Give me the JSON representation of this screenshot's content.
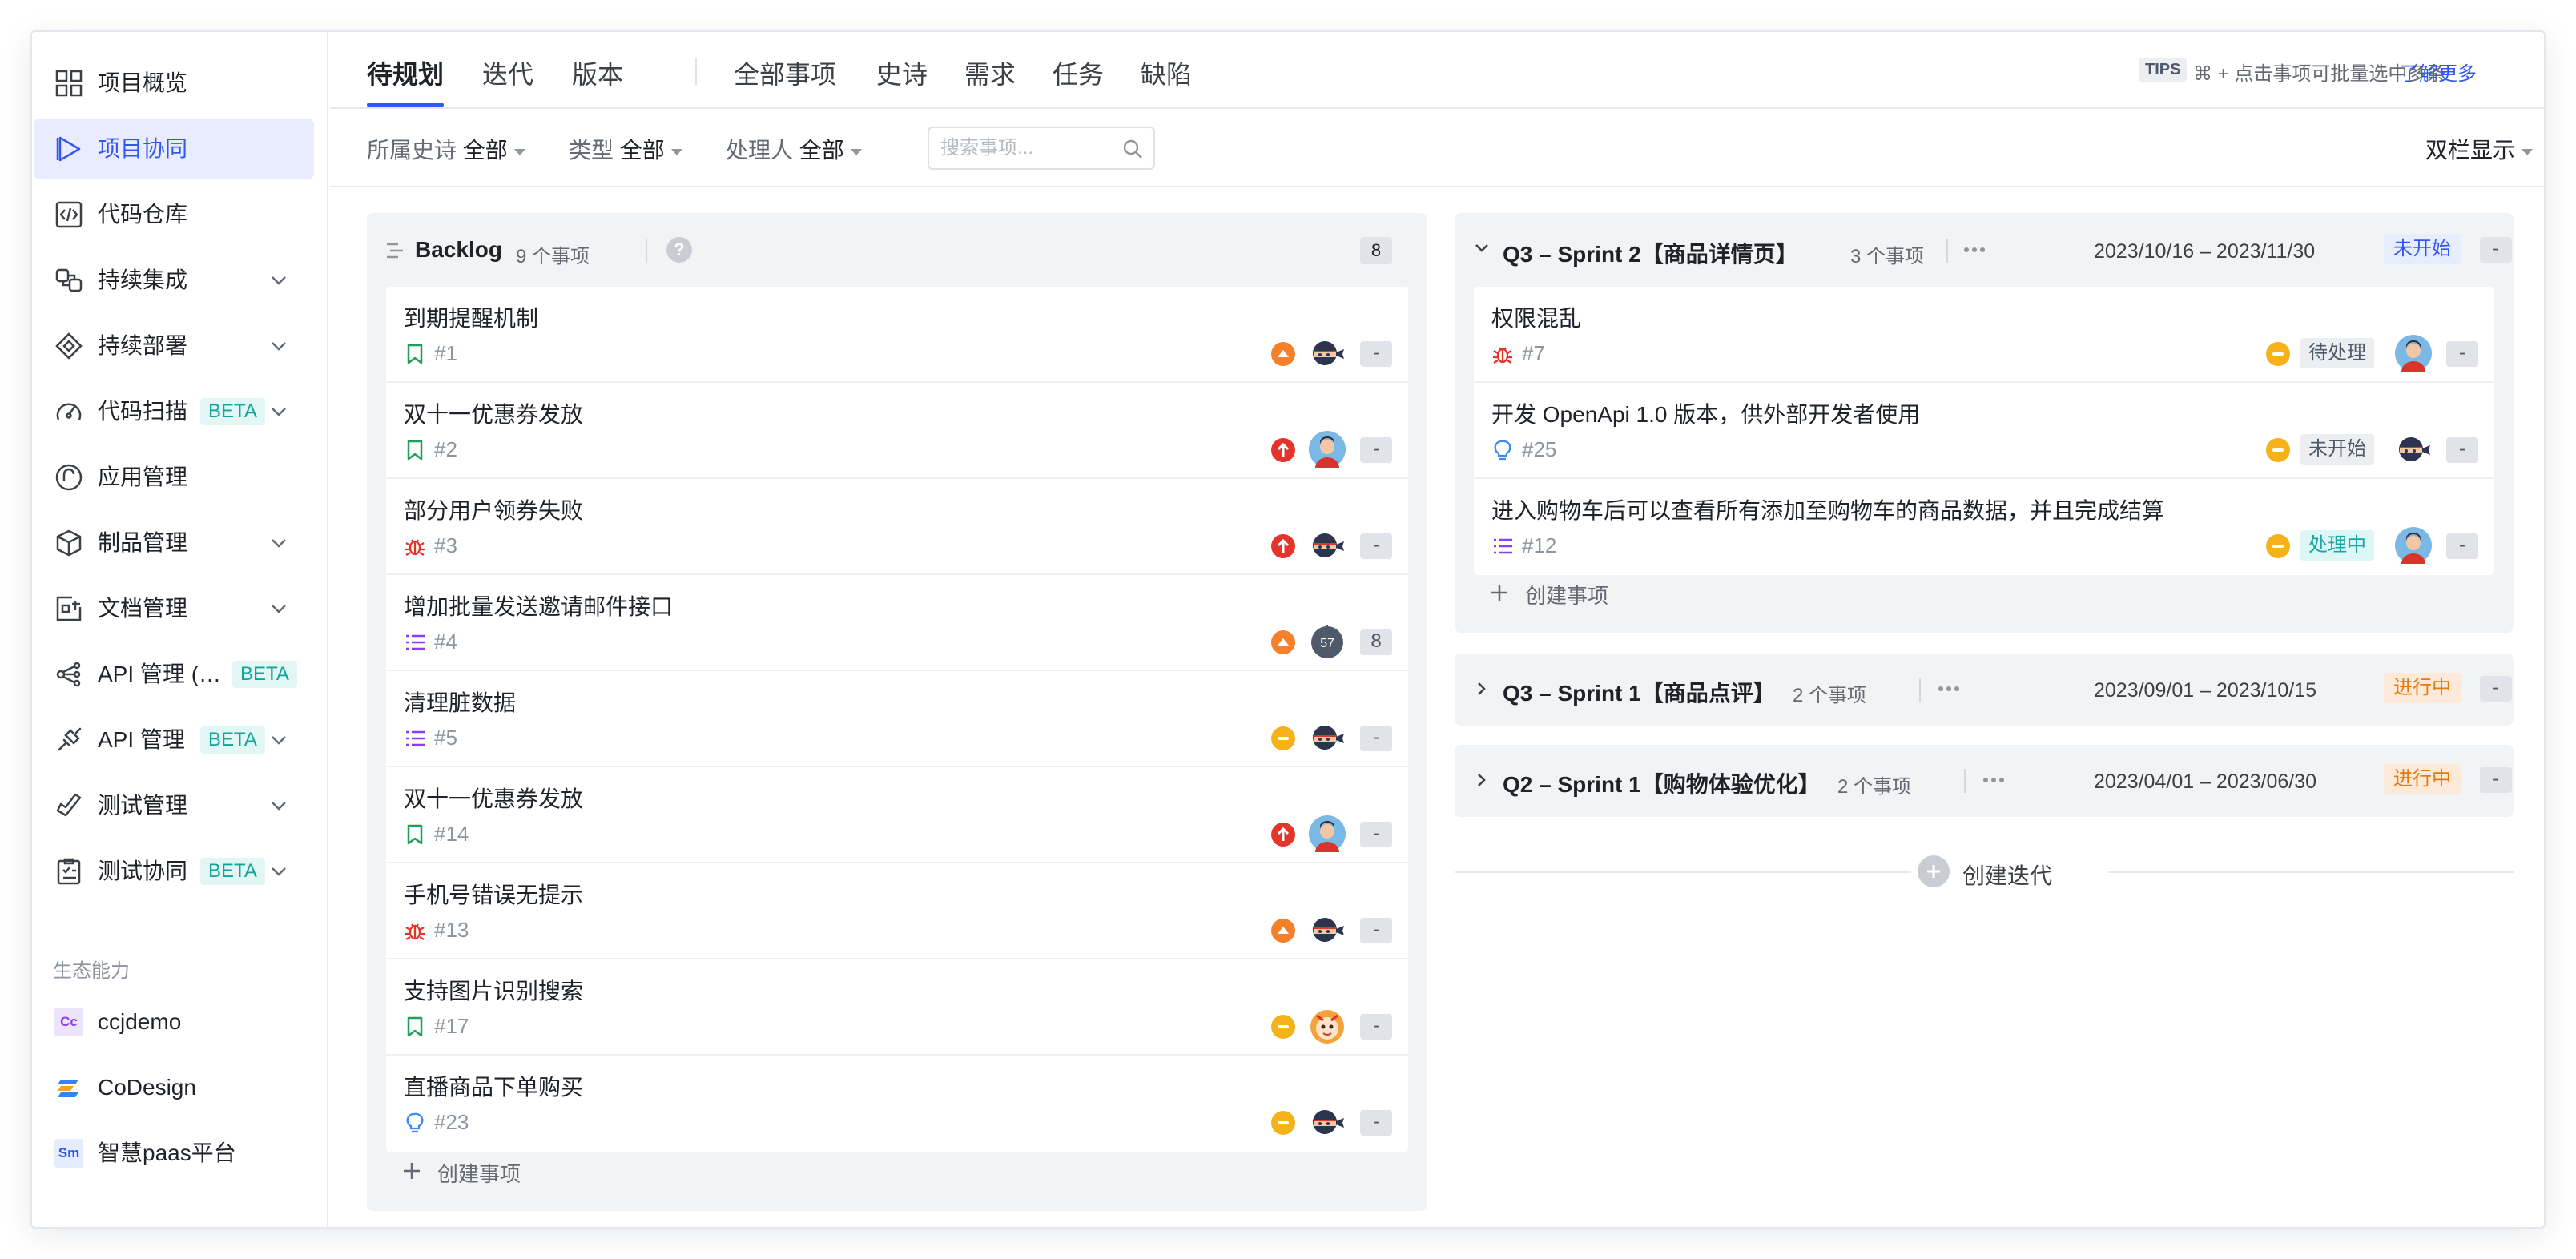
{
  "sidebar": {
    "items": [
      {
        "label": "项目概览",
        "icon": "grid-icon"
      },
      {
        "label": "项目协同",
        "icon": "play-icon"
      },
      {
        "label": "代码仓库",
        "icon": "code-icon"
      },
      {
        "label": "持续集成",
        "icon": "integration-icon"
      },
      {
        "label": "持续部署",
        "icon": "deploy-icon"
      },
      {
        "label": "代码扫描",
        "icon": "gauge-icon",
        "badge": "BETA"
      },
      {
        "label": "应用管理",
        "icon": "app-icon"
      },
      {
        "label": "制品管理",
        "icon": "box-icon"
      },
      {
        "label": "文档管理",
        "icon": "document-icon"
      },
      {
        "label": "API 管理 (…",
        "icon": "api-share-icon",
        "badge": "BETA"
      },
      {
        "label": "API 管理",
        "icon": "api-plug-icon",
        "badge": "BETA"
      },
      {
        "label": "测试管理",
        "icon": "test-icon"
      },
      {
        "label": "测试协同",
        "icon": "checklist-icon",
        "badge": "BETA"
      }
    ],
    "section_label": "生态能力",
    "eco": [
      {
        "label": "ccjdemo",
        "logo": "Cc"
      },
      {
        "label": "CoDesign",
        "logo": ""
      },
      {
        "label": "智慧paas平台",
        "logo": "Sm"
      }
    ]
  },
  "tabs": [
    "待规划",
    "迭代",
    "版本",
    "全部事项",
    "史诗",
    "需求",
    "任务",
    "缺陷"
  ],
  "tips": {
    "badge": "TIPS",
    "text": "⌘ + 点击事项可批量选中多条",
    "link": "了解更多"
  },
  "filters": {
    "epic": {
      "label": "所属史诗",
      "value": "全部"
    },
    "type": {
      "label": "类型",
      "value": "全部"
    },
    "assignee": {
      "label": "处理人",
      "value": "全部"
    },
    "search_placeholder": "搜索事项...",
    "view": "双栏显示"
  },
  "backlog": {
    "title": "Backlog",
    "count": "9 个事项",
    "help": "?",
    "pill": "8",
    "create": "创建事项",
    "items": [
      {
        "title": "到期提醒机制",
        "num": "#1",
        "type": "story",
        "priority": "high",
        "avatar": "ninja",
        "extra": "-"
      },
      {
        "title": "双十一优惠券发放",
        "num": "#2",
        "type": "story",
        "priority": "urgent",
        "avatar": "man",
        "extra": "-"
      },
      {
        "title": "部分用户领券失败",
        "num": "#3",
        "type": "bug",
        "priority": "urgent",
        "avatar": "ninja",
        "extra": "-"
      },
      {
        "title": "增加批量发送邀请邮件接口",
        "num": "#4",
        "type": "task",
        "priority": "high",
        "avatar": "dark",
        "avatar_text": "57",
        "extra": "8"
      },
      {
        "title": "清理脏数据",
        "num": "#5",
        "type": "task",
        "priority": "medium",
        "avatar": "ninja",
        "extra": "-"
      },
      {
        "title": "双十一优惠券发放",
        "num": "#14",
        "type": "story",
        "priority": "urgent",
        "avatar": "man",
        "extra": "-"
      },
      {
        "title": "手机号错误无提示",
        "num": "#13",
        "type": "bug",
        "priority": "high",
        "avatar": "ninja",
        "extra": "-"
      },
      {
        "title": "支持图片识别搜索",
        "num": "#17",
        "type": "story",
        "priority": "medium",
        "avatar": "cartoon",
        "extra": "-"
      },
      {
        "title": "直播商品下单购买",
        "num": "#23",
        "type": "idea",
        "priority": "medium",
        "avatar": "ninja",
        "extra": "-"
      }
    ]
  },
  "sprints": [
    {
      "title": "Q3 – Sprint 2【商品详情页】",
      "count": "3 个事项",
      "dates": "2023/10/16 – 2023/11/30",
      "status": "未开始",
      "extra": "-",
      "create": "创建事项",
      "items": [
        {
          "title": "权限混乱",
          "num": "#7",
          "type": "bug",
          "priority": "medium",
          "state": "待处理",
          "avatar": "man",
          "extra": "-"
        },
        {
          "title": "开发 OpenApi 1.0 版本，供外部开发者使用",
          "num": "#25",
          "type": "idea",
          "priority": "medium",
          "state": "未开始",
          "avatar": "ninja",
          "extra": "-"
        },
        {
          "title": "进入购物车后可以查看所有添加至购物车的商品数据，并且完成结算",
          "num": "#12",
          "type": "task",
          "priority": "medium",
          "state": "处理中",
          "avatar": "man",
          "extra": "-"
        }
      ]
    },
    {
      "title": "Q3 – Sprint 1【商品点评】",
      "count": "2 个事项",
      "dates": "2023/09/01 – 2023/10/15",
      "status": "进行中",
      "extra": "-"
    },
    {
      "title": "Q2 – Sprint 1【购物体验优化】",
      "count": "2 个事项",
      "dates": "2023/04/01 – 2023/06/30",
      "status": "进行中",
      "extra": "-"
    }
  ],
  "create_iteration": "创建迭代",
  "colors": {
    "accent": "#3157f2",
    "priority_urgent": "#e5352b",
    "priority_high": "#f5802a",
    "priority_medium": "#f7b21b",
    "story": "#1fa05a",
    "bug": "#e0352b",
    "task": "#8a3ef0",
    "idea": "#3a8af0"
  }
}
